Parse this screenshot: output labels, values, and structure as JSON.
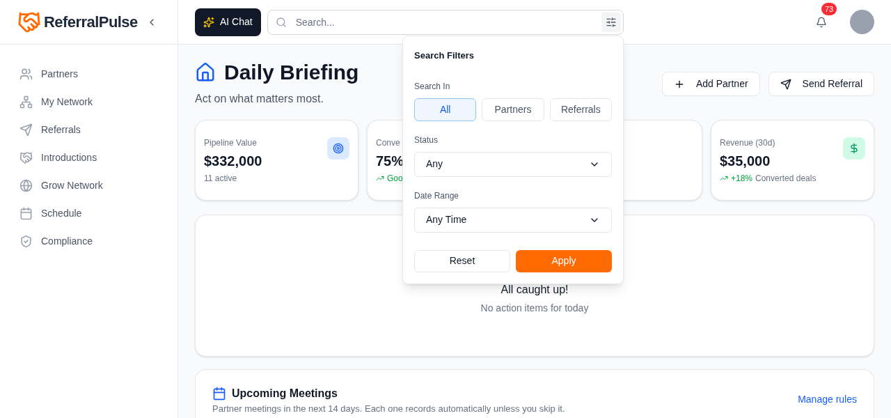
{
  "brand": {
    "name": "ReferralPulse"
  },
  "sidebar": {
    "items": [
      {
        "label": "Partners",
        "selected": false
      },
      {
        "label": "My Network",
        "selected": false
      },
      {
        "label": "Referrals",
        "selected": false
      },
      {
        "label": "Introductions",
        "selected": false
      },
      {
        "label": "Grow Network",
        "selected": false
      },
      {
        "label": "Schedule",
        "selected": false
      },
      {
        "label": "Compliance",
        "selected": false
      }
    ]
  },
  "topbar": {
    "ai_button": "AI Chat",
    "search": {
      "placeholder": "Search..."
    },
    "notifications": {
      "count": "73"
    }
  },
  "page": {
    "title": "Daily Briefing",
    "subtitle": "Act on what matters most.",
    "actions": [
      {
        "label": "Add Partner"
      },
      {
        "label": "Send Referral"
      }
    ]
  },
  "stats": [
    {
      "kind": "metric",
      "label": "Pipeline Value",
      "value": "$332,000",
      "note": "11 active"
    },
    {
      "kind": "metric",
      "label": "Conve",
      "value": "75%",
      "trend": "Goo"
    },
    {
      "kind": "covered"
    },
    {
      "kind": "metric",
      "label": "Revenue (30d)",
      "value": "$35,000",
      "trend": "+18%",
      "note": "Converted deals"
    }
  ],
  "empty_state": {
    "title": "All caught up!",
    "text": "No action items for today"
  },
  "meetings": {
    "title": "Upcoming Meetings",
    "subtitle": "Partner meetings in the next 14 days. Each one records automatically unless you skip it.",
    "link": "Manage rules"
  },
  "filters": {
    "title": "Search Filters",
    "search_in_label": "Search In",
    "search_in": [
      {
        "label": "All",
        "selected": true
      },
      {
        "label": "Partners",
        "selected": false
      },
      {
        "label": "Referrals",
        "selected": false
      }
    ],
    "status_label": "Status",
    "status_value": "Any",
    "date_label": "Date Range",
    "date_value": "Any Time",
    "reset": "Reset",
    "apply": "Apply"
  }
}
